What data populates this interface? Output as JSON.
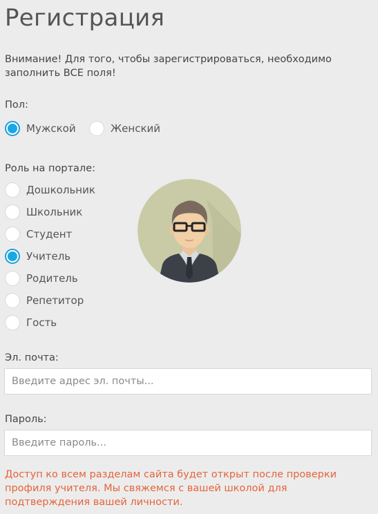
{
  "page": {
    "title": "Регистрация",
    "notice": "Внимание! Для того, чтобы зарегистрироваться, необходимо заполнить ВСЕ поля!"
  },
  "gender": {
    "label": "Пол:",
    "options": [
      "Мужской",
      "Женский"
    ],
    "selected": "Мужской"
  },
  "role": {
    "label": "Роль на портале:",
    "options": [
      "Дошкольник",
      "Школьник",
      "Студент",
      "Учитель",
      "Родитель",
      "Репетитор",
      "Гость"
    ],
    "selected": "Учитель"
  },
  "email": {
    "label": "Эл. почта:",
    "placeholder": "Введите адрес эл. почты...",
    "value": ""
  },
  "password": {
    "label": "Пароль:",
    "placeholder": "Введите пароль...",
    "value": ""
  },
  "warning": "Доступ ко всем разделам сайта будет открыт после проверки профиля учителя. Мы свяжемся с вашей школой для подтверждения вашей личности.",
  "colors": {
    "accent": "#1aa7e6",
    "warning": "#e5643b",
    "background": "#ececec"
  },
  "avatar_icon": "teacher-avatar-icon"
}
